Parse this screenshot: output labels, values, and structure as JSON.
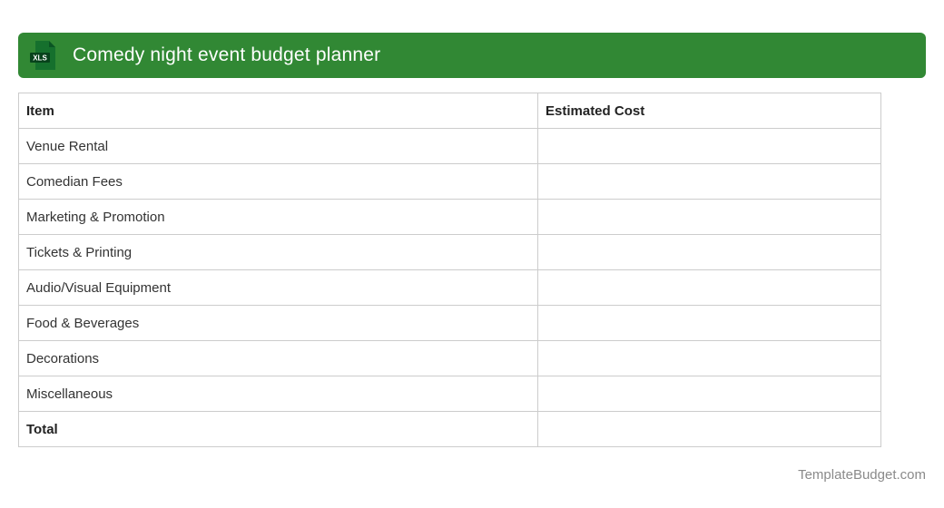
{
  "header": {
    "title": "Comedy night event budget planner",
    "icon_label": "XLS",
    "bg_color": "#318834",
    "text_color": "#ffffff",
    "icon_doc_color": "#15702d",
    "icon_fold_color": "#0a5423",
    "icon_badge_color": "#07421b"
  },
  "table": {
    "columns": [
      "Item",
      "Estimated Cost"
    ],
    "border_color": "#cccccc",
    "rows": [
      {
        "item": "Venue Rental",
        "estimated_cost": "",
        "bold": false
      },
      {
        "item": "Comedian Fees",
        "estimated_cost": "",
        "bold": false
      },
      {
        "item": "Marketing & Promotion",
        "estimated_cost": "",
        "bold": false
      },
      {
        "item": "Tickets & Printing",
        "estimated_cost": "",
        "bold": false
      },
      {
        "item": "Audio/Visual Equipment",
        "estimated_cost": "",
        "bold": false
      },
      {
        "item": "Food & Beverages",
        "estimated_cost": "",
        "bold": false
      },
      {
        "item": "Decorations",
        "estimated_cost": "",
        "bold": false
      },
      {
        "item": "Miscellaneous",
        "estimated_cost": "",
        "bold": false
      },
      {
        "item": "Total",
        "estimated_cost": "",
        "bold": true
      }
    ]
  },
  "footer": {
    "brand": "TemplateBudget.com",
    "text_color": "#8a8a8a"
  }
}
